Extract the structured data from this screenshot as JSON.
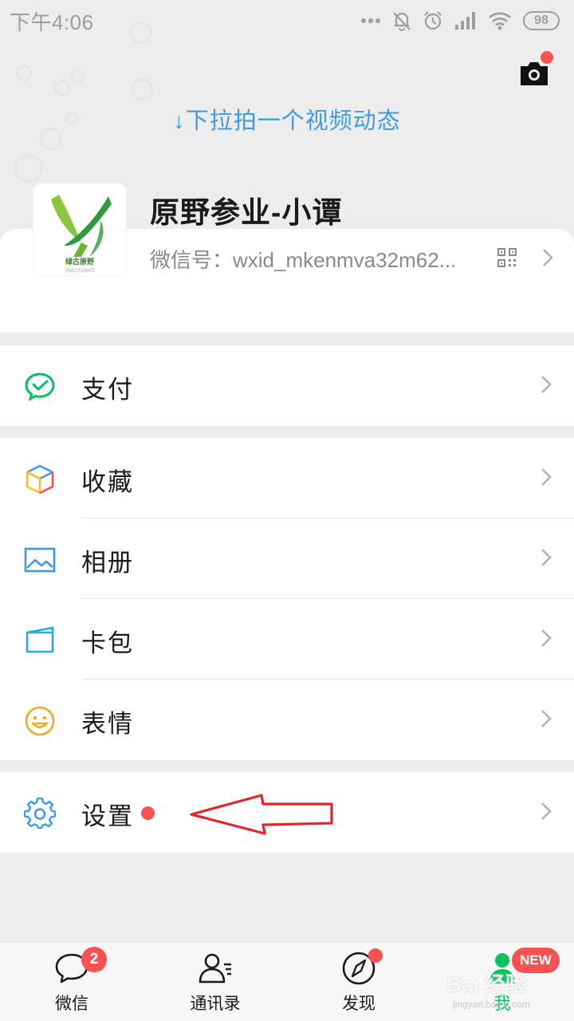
{
  "status_bar": {
    "time": "下午4:06",
    "battery": "98",
    "icons": [
      "more-dots-icon",
      "bell-off-icon",
      "alarm-icon",
      "signal-icon",
      "wifi-icon",
      "battery-icon"
    ]
  },
  "header": {
    "pull_hint": "↓下拉拍一个视频动态",
    "camera_icon": "camera-icon",
    "camera_has_dot": true
  },
  "profile": {
    "nickname": "原野参业-小谭",
    "wechat_id": "微信号：wxid_mkenmva32m62...",
    "avatar_caption": "绿古原野",
    "avatar_caption_small": "JINGYUANYE",
    "qr_icon": "qr-code-icon"
  },
  "menu": {
    "pay": {
      "label": "支付",
      "icon": "wechat-pay-icon"
    },
    "favorites": {
      "label": "收藏",
      "icon": "cube-icon"
    },
    "album": {
      "label": "相册",
      "icon": "image-icon"
    },
    "card_pack": {
      "label": "卡包",
      "icon": "card-pack-icon"
    },
    "stickers": {
      "label": "表情",
      "icon": "smiley-icon"
    },
    "settings": {
      "label": "设置",
      "icon": "gear-icon",
      "has_dot": true
    }
  },
  "annotation": {
    "type": "red-arrow",
    "points_to": "settings"
  },
  "tabs": [
    {
      "label": "微信",
      "icon": "chat-bubble-icon",
      "badge": "2"
    },
    {
      "label": "通讯录",
      "icon": "contacts-icon"
    },
    {
      "label": "发现",
      "icon": "compass-icon",
      "has_dot": true
    },
    {
      "label": "我",
      "icon": "person-icon",
      "badge": "NEW",
      "active": true
    }
  ],
  "watermark": {
    "text": "Bai 经验",
    "sub": "jingyan.baidu.com"
  },
  "colors": {
    "accent_green": "#07c160",
    "badge_red": "#fa5151",
    "link_blue": "#3f9be8",
    "background": "#ededed"
  }
}
